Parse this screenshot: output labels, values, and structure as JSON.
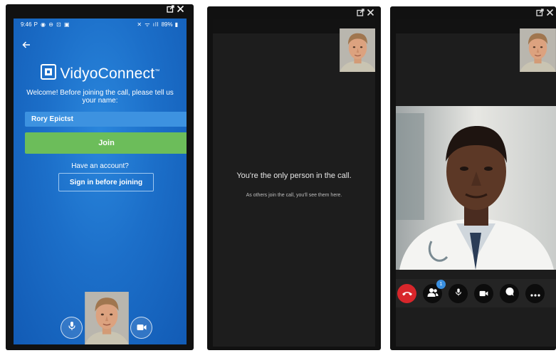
{
  "panel1": {
    "status": {
      "time": "9:46",
      "battery": "89%"
    },
    "brand": "VidyoConnect",
    "welcome": "Welcome! Before joining the call, please tell us your name:",
    "name_value": "Rory Epictst",
    "join_label": "Join",
    "have_account": "Have an account?",
    "signin_label": "Sign in before joining"
  },
  "panel2": {
    "only_person": "You're the only person in the call.",
    "others_join": "As others join the call, you'll see them here."
  },
  "panel3": {
    "participants_badge": "1"
  },
  "icons": [
    "external-window-icon",
    "close-icon",
    "back-arrow-icon",
    "microphone-icon",
    "video-camera-icon",
    "hang-up-icon",
    "participants-icon",
    "chat-icon",
    "more-icon"
  ],
  "colors": {
    "brand_blue": "#1c6fc9",
    "join_green": "#6cbd5a",
    "hangup_red": "#d8262b",
    "dark_bg": "#1d1d1d"
  }
}
